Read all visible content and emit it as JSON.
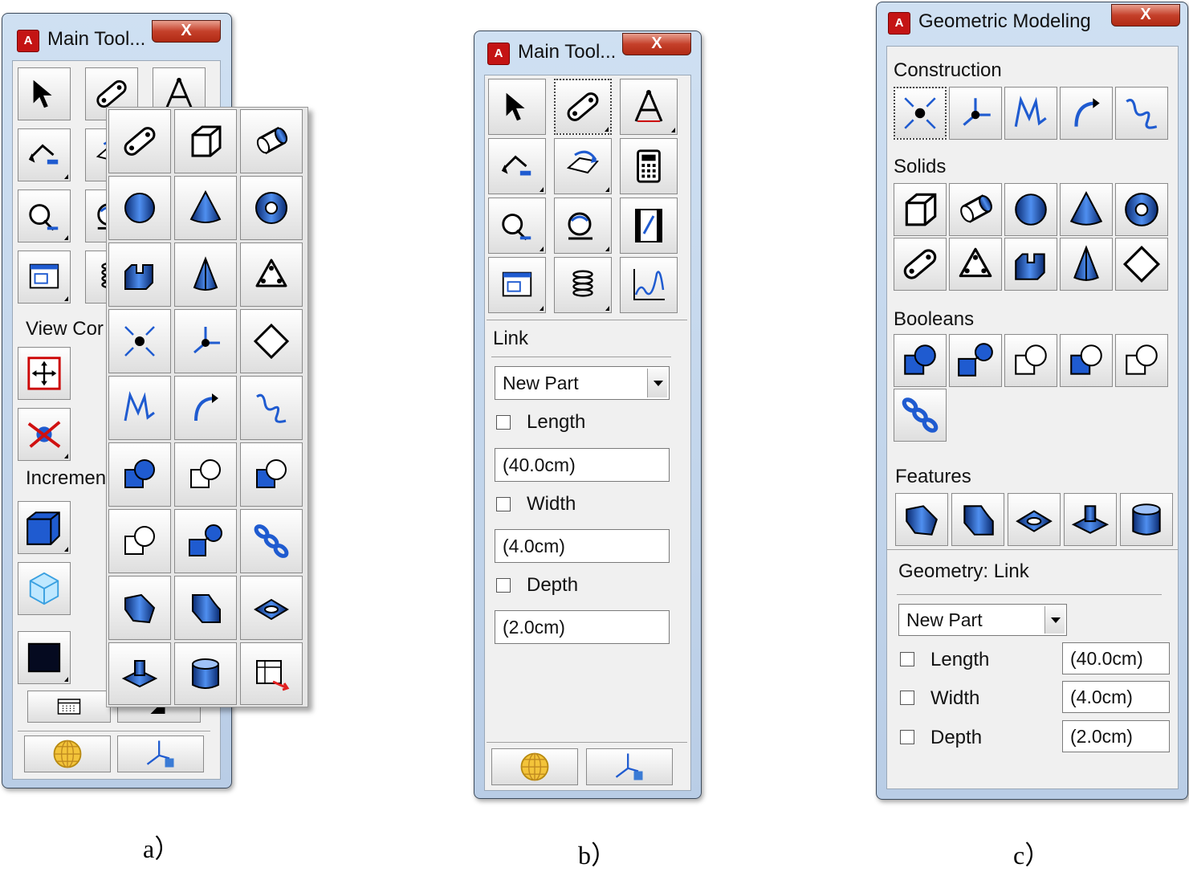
{
  "panel_a": {
    "window_title": "Main Tool...",
    "close_glyph": "X",
    "app_icon_letter": "A",
    "section_view": "View Cor",
    "section_increment": "Incremen",
    "caption": "a）"
  },
  "panel_b": {
    "window_title": "Main Tool...",
    "close_glyph": "X",
    "app_icon_letter": "A",
    "heading": "Link",
    "select_value": "New Part",
    "length_label": "Length",
    "length_value": "(40.0cm)",
    "width_label": "Width",
    "width_value": "(4.0cm)",
    "depth_label": "Depth",
    "depth_value": "(2.0cm)",
    "caption": "b）"
  },
  "panel_c": {
    "window_title": "Geometric Modeling",
    "close_glyph": "X",
    "app_icon_letter": "A",
    "section_construction": "Construction",
    "section_solids": "Solids",
    "section_booleans": "Booleans",
    "section_features": "Features",
    "geometry_heading": "Geometry: Link",
    "select_value": "New Part",
    "length_label": "Length",
    "length_value": "(40.0cm)",
    "width_label": "Width",
    "width_value": "(4.0cm)",
    "depth_label": "Depth",
    "depth_value": "(2.0cm)",
    "caption": "c）"
  },
  "colors": {
    "icon_blue": "#1f5bd0",
    "close_red": "#c5402a",
    "title_bar": "#cfe0f2"
  }
}
